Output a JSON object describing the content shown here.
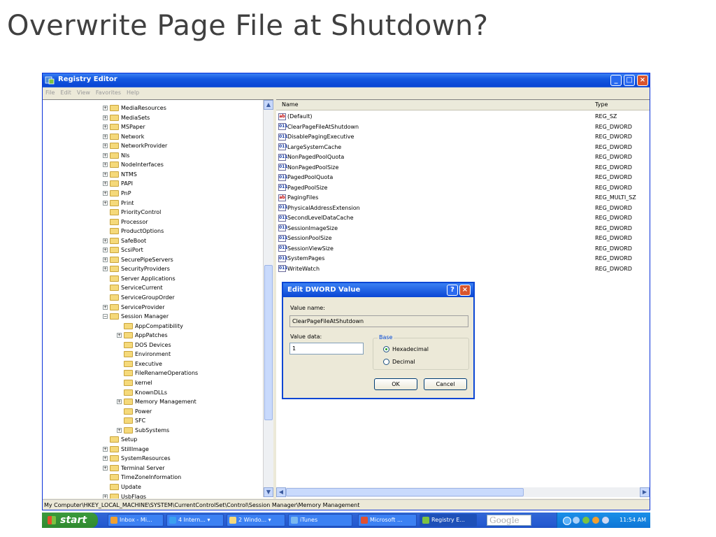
{
  "slide": {
    "title": "Overwrite Page File at Shutdown?"
  },
  "window": {
    "title": "Registry Editor",
    "menu": [
      "File",
      "Edit",
      "View",
      "Favorites",
      "Help"
    ],
    "minimize": "_",
    "maximize": "□",
    "close": "×"
  },
  "tree": [
    {
      "label": "MediaResources",
      "expander": "+"
    },
    {
      "label": "MediaSets",
      "expander": "+"
    },
    {
      "label": "MSPaper",
      "expander": "+"
    },
    {
      "label": "Network",
      "expander": "+"
    },
    {
      "label": "NetworkProvider",
      "expander": "+"
    },
    {
      "label": "Nls",
      "expander": "+"
    },
    {
      "label": "NodeInterfaces",
      "expander": "+"
    },
    {
      "label": "NTMS",
      "expander": "+"
    },
    {
      "label": "PAPI",
      "expander": "+"
    },
    {
      "label": "PnP",
      "expander": "+"
    },
    {
      "label": "Print",
      "expander": "+"
    },
    {
      "label": "PriorityControl",
      "expander": ""
    },
    {
      "label": "Processor",
      "expander": ""
    },
    {
      "label": "ProductOptions",
      "expander": ""
    },
    {
      "label": "SafeBoot",
      "expander": "+"
    },
    {
      "label": "ScsiPort",
      "expander": "+"
    },
    {
      "label": "SecurePipeServers",
      "expander": "+"
    },
    {
      "label": "SecurityProviders",
      "expander": "+"
    },
    {
      "label": "Server Applications",
      "expander": ""
    },
    {
      "label": "ServiceCurrent",
      "expander": ""
    },
    {
      "label": "ServiceGroupOrder",
      "expander": ""
    },
    {
      "label": "ServiceProvider",
      "expander": "+"
    },
    {
      "label": "Session Manager",
      "expander": "−"
    },
    {
      "label": "AppCompatibility",
      "expander": "",
      "indent": 1
    },
    {
      "label": "AppPatches",
      "expander": "+",
      "indent": 1
    },
    {
      "label": "DOS Devices",
      "expander": "",
      "indent": 1
    },
    {
      "label": "Environment",
      "expander": "",
      "indent": 1
    },
    {
      "label": "Executive",
      "expander": "",
      "indent": 1
    },
    {
      "label": "FileRenameOperations",
      "expander": "",
      "indent": 1
    },
    {
      "label": "kernel",
      "expander": "",
      "indent": 1
    },
    {
      "label": "KnownDLLs",
      "expander": "",
      "indent": 1
    },
    {
      "label": "Memory Management",
      "expander": "+",
      "indent": 1
    },
    {
      "label": "Power",
      "expander": "",
      "indent": 1
    },
    {
      "label": "SFC",
      "expander": "",
      "indent": 1
    },
    {
      "label": "SubSystems",
      "expander": "+",
      "indent": 1
    },
    {
      "label": "Setup",
      "expander": ""
    },
    {
      "label": "StillImage",
      "expander": "+"
    },
    {
      "label": "SystemResources",
      "expander": "+"
    },
    {
      "label": "Terminal Server",
      "expander": "+"
    },
    {
      "label": "TimeZoneInformation",
      "expander": ""
    },
    {
      "label": "Update",
      "expander": ""
    },
    {
      "label": "UsbFlags",
      "expander": "+"
    }
  ],
  "list": {
    "col_name": "Name",
    "col_type": "Type",
    "rows": [
      {
        "name": "(Default)",
        "type": "REG_SZ",
        "icon": "ab"
      },
      {
        "name": "ClearPageFileAtShutdown",
        "type": "REG_DWORD",
        "icon": "dw"
      },
      {
        "name": "DisablePagingExecutive",
        "type": "REG_DWORD",
        "icon": "dw"
      },
      {
        "name": "LargeSystemCache",
        "type": "REG_DWORD",
        "icon": "dw"
      },
      {
        "name": "NonPagedPoolQuota",
        "type": "REG_DWORD",
        "icon": "dw"
      },
      {
        "name": "NonPagedPoolSize",
        "type": "REG_DWORD",
        "icon": "dw"
      },
      {
        "name": "PagedPoolQuota",
        "type": "REG_DWORD",
        "icon": "dw"
      },
      {
        "name": "PagedPoolSize",
        "type": "REG_DWORD",
        "icon": "dw"
      },
      {
        "name": "PagingFiles",
        "type": "REG_MULTI_SZ",
        "icon": "ab"
      },
      {
        "name": "PhysicalAddressExtension",
        "type": "REG_DWORD",
        "icon": "dw"
      },
      {
        "name": "SecondLevelDataCache",
        "type": "REG_DWORD",
        "icon": "dw"
      },
      {
        "name": "SessionImageSize",
        "type": "REG_DWORD",
        "icon": "dw"
      },
      {
        "name": "SessionPoolSize",
        "type": "REG_DWORD",
        "icon": "dw"
      },
      {
        "name": "SessionViewSize",
        "type": "REG_DWORD",
        "icon": "dw"
      },
      {
        "name": "SystemPages",
        "type": "REG_DWORD",
        "icon": "dw"
      },
      {
        "name": "WriteWatch",
        "type": "REG_DWORD",
        "icon": "dw"
      }
    ]
  },
  "icon_labels": {
    "ab": "ab",
    "dw": "011"
  },
  "statusbar": {
    "path": "My Computer\\HKEY_LOCAL_MACHINE\\SYSTEM\\CurrentControlSet\\Control\\Session Manager\\Memory Management"
  },
  "dialog": {
    "title": "Edit DWORD Value",
    "help": "?",
    "close": "×",
    "value_name_label": "Value name:",
    "value_name": "ClearPageFileAtShutdown",
    "value_data_label": "Value data:",
    "value_data": "1",
    "base_label": "Base",
    "hex_label": "Hexadecimal",
    "dec_label": "Decimal",
    "selected_base": "hexadecimal",
    "ok": "OK",
    "cancel": "Cancel"
  },
  "taskbar": {
    "start": "start",
    "tasks": [
      {
        "label": "Inbox - Mi...",
        "color": "#f0a030"
      },
      {
        "label": "4 Intern...  ▾",
        "color": "#3aa0f0"
      },
      {
        "label": "2 Windo...  ▾",
        "color": "#f5d97a"
      },
      {
        "label": "iTunes",
        "color": "#7ab8f0"
      },
      {
        "label": "Microsoft ...",
        "color": "#e05030"
      },
      {
        "label": "Registry E...",
        "color": "#7cc241",
        "active": true
      }
    ],
    "google": "Google",
    "clock": "11:54 AM"
  },
  "colors": {
    "accent": "#0a46d4",
    "start_green": "#2f8a2f",
    "tray_blue": "#0f76d6"
  }
}
